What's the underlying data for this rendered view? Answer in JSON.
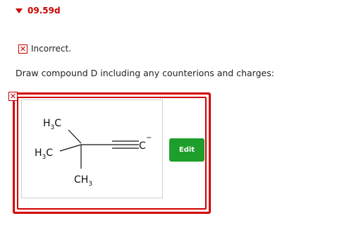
{
  "header": {
    "score": "09.59d"
  },
  "status": {
    "icon": "x-mark-icon",
    "text": "Incorrect."
  },
  "prompt": {
    "text": "Draw compound D including any counterions and charges:"
  },
  "molecule": {
    "top_methyl": {
      "main": "H",
      "sub": "3",
      "tail": "C"
    },
    "left_methyl": {
      "main": "H",
      "sub": "3",
      "tail": "C"
    },
    "bottom_methyl": {
      "main": "CH",
      "sub": "3"
    },
    "terminal_atom": "C",
    "charge": "−"
  },
  "edit_button": {
    "label": "Edit",
    "color": "#1e9e2a"
  },
  "colors": {
    "error_red": "#cc0000",
    "border_red": "#d40000"
  }
}
